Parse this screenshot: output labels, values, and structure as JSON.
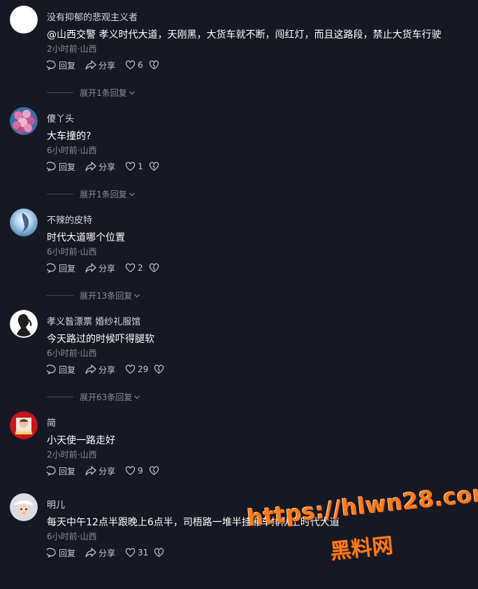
{
  "comments": [
    {
      "username": "没有抑郁的悲观主义者",
      "content": "@山西交警 孝义时代大道，天刚黑，大货车就不断，闯红灯，而且这路段，禁止大货车行驶",
      "meta": "2小时前·山西",
      "reply_label": "回复",
      "share_label": "分享",
      "likes": "6",
      "expand_label": "展开1条回复"
    },
    {
      "username": "傻丫头",
      "content": "大车撞的?",
      "meta": "6小时前·山西",
      "reply_label": "回复",
      "share_label": "分享",
      "likes": "1",
      "expand_label": "展开1条回复"
    },
    {
      "username": "不辣的皮特",
      "content": "时代大道哪个位置",
      "meta": "6小时前·山西",
      "reply_label": "回复",
      "share_label": "分享",
      "likes": "2",
      "expand_label": "展开13条回复"
    },
    {
      "username": "孝义昝漂票 婚纱礼服馆",
      "content": "今天路过的时候吓得腿软",
      "meta": "6小时前·山西",
      "reply_label": "回复",
      "share_label": "分享",
      "likes": "29",
      "expand_label": "展开63条回复"
    },
    {
      "username": "简",
      "content": "小天使一路走好",
      "meta": "2小时前·山西",
      "reply_label": "回复",
      "share_label": "分享",
      "likes": "9",
      "expand_label": ""
    },
    {
      "username": "明儿",
      "content": "每天中午12点半跟晚上6点半，司梧路一堆半挂厢车排队上时代大道",
      "meta": "6小时前·山西",
      "reply_label": "回复",
      "share_label": "分享",
      "likes": "31",
      "expand_label": ""
    }
  ],
  "watermark": {
    "url": "https://hlwn28.com",
    "name": "黑料网"
  },
  "colors": {
    "background": "#161823",
    "accent_watermark": "#ff7b1c"
  }
}
